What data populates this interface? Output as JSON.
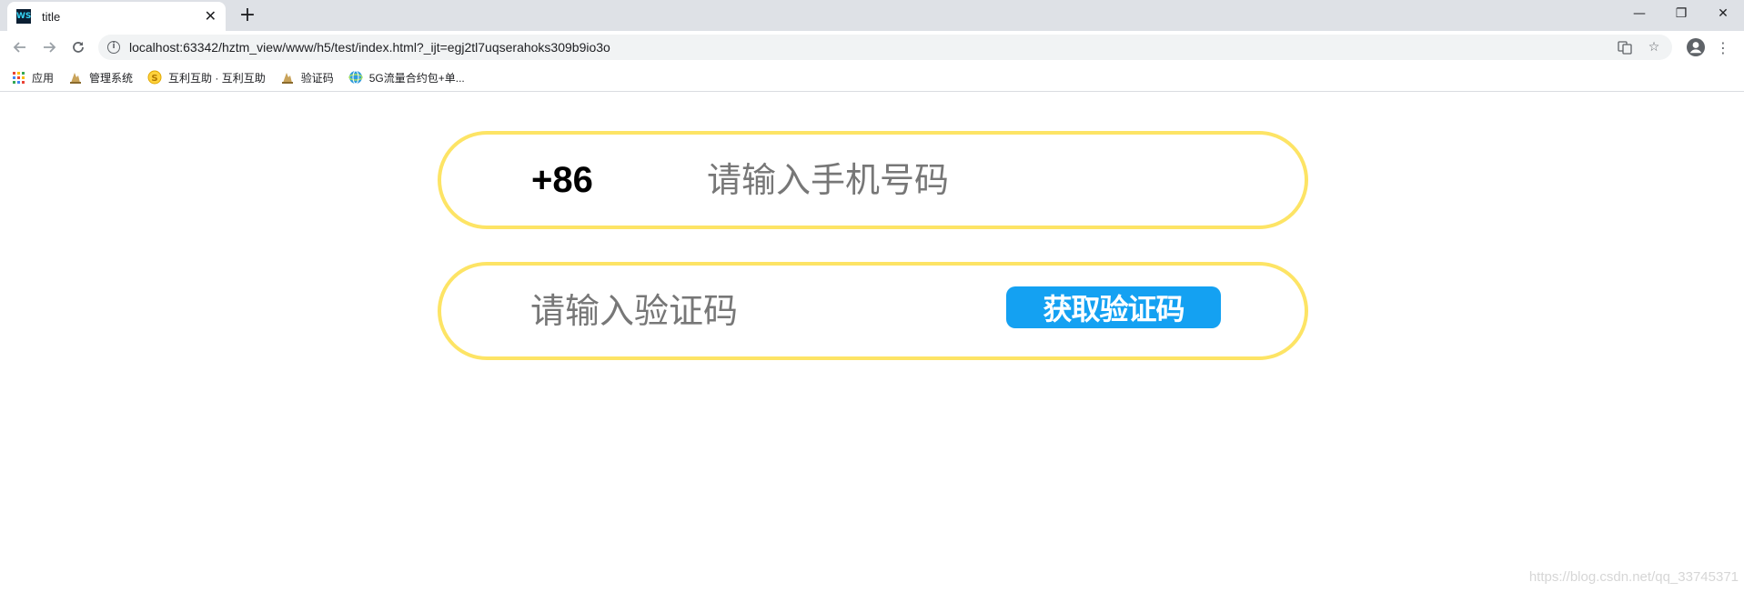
{
  "browser": {
    "tab": {
      "favicon_text": "WS",
      "title": "title"
    },
    "new_tab_label": "+",
    "window_controls": {
      "minimize": "—",
      "restore": "❐",
      "close": "✕"
    },
    "address_bar": {
      "url": "localhost:63342/hztm_view/www/h5/test/index.html?_ijt=egj2tl7uqserahoks309b9io3o"
    },
    "bookmarks": [
      {
        "label": "应用",
        "icon": "apps-grid-icon"
      },
      {
        "label": "管理系统",
        "icon": "bookmark-site-icon"
      },
      {
        "label": "互利互助 · 互利互助",
        "icon": "bookmark-coin-icon"
      },
      {
        "label": "验证码",
        "icon": "bookmark-site-icon"
      },
      {
        "label": "5G流量合约包+单...",
        "icon": "bookmark-globe-icon"
      }
    ]
  },
  "colors": {
    "pill_border": "#fde465",
    "button_bg": "#14a1f2",
    "button_text": "#ffffff",
    "placeholder": "#777777"
  },
  "form": {
    "country_code": "+86",
    "phone_placeholder": "请输入手机号码",
    "code_placeholder": "请输入验证码",
    "get_code_label": "获取验证码"
  },
  "watermark": "https://blog.csdn.net/qq_33745371"
}
